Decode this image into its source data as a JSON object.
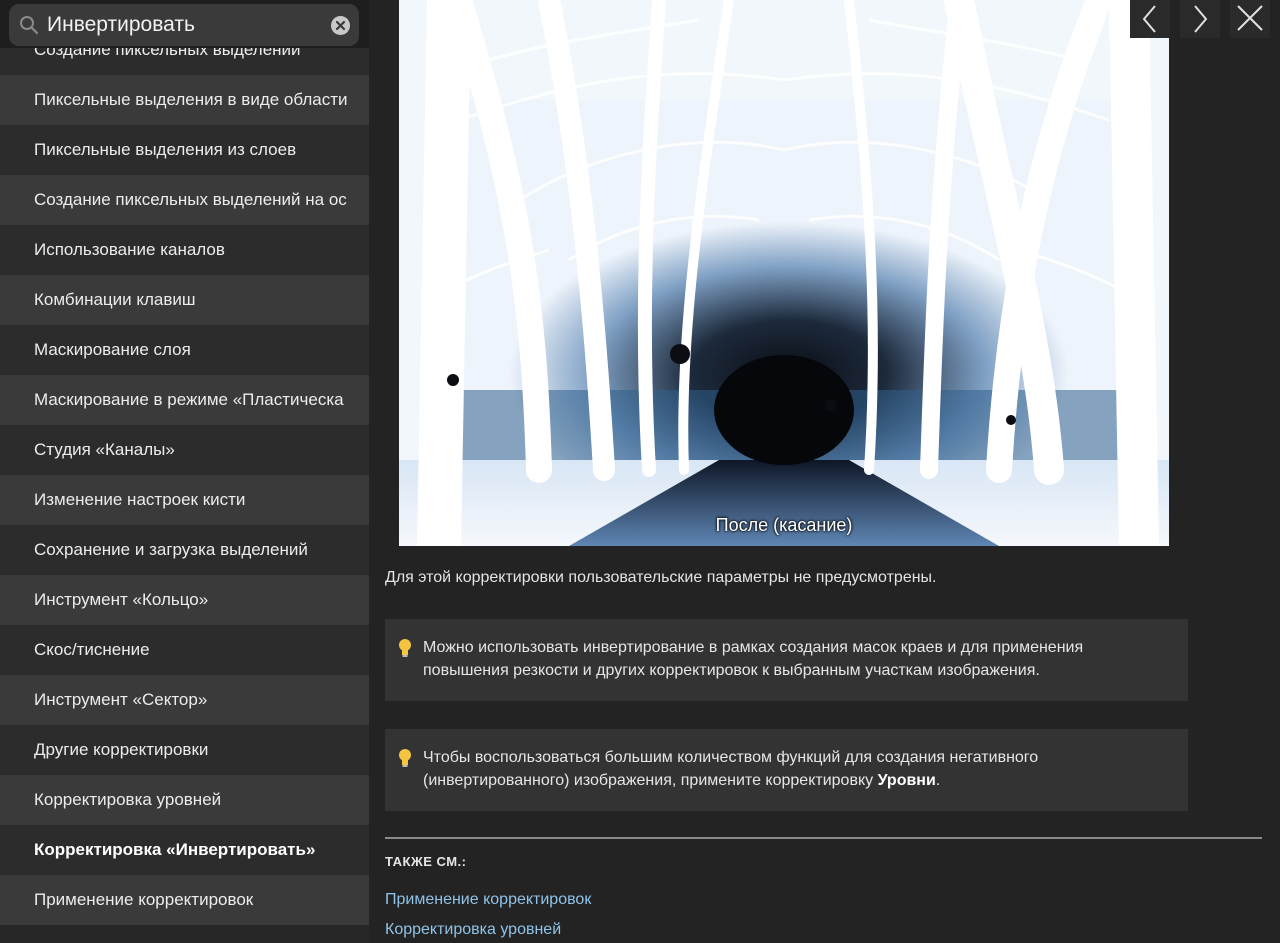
{
  "search": {
    "value": "Инвертировать",
    "icon": "search-icon",
    "clear_icon": "clear-icon"
  },
  "sidebar": {
    "items": [
      {
        "label": "Создание пиксельных выделений"
      },
      {
        "label": "Пиксельные выделения в виде области"
      },
      {
        "label": "Пиксельные выделения из слоев"
      },
      {
        "label": "Создание пиксельных выделений на ос"
      },
      {
        "label": "Использование каналов"
      },
      {
        "label": "Комбинации клавиш"
      },
      {
        "label": "Маскирование слоя"
      },
      {
        "label": "Маскирование в режиме «Пластическа"
      },
      {
        "label": "Студия «Каналы»"
      },
      {
        "label": "Изменение настроек кисти"
      },
      {
        "label": "Сохранение и загрузка выделений"
      },
      {
        "label": "Инструмент «Кольцо»"
      },
      {
        "label": "Скос/тиснение"
      },
      {
        "label": "Инструмент «Сектор»"
      },
      {
        "label": "Другие корректировки"
      },
      {
        "label": "Корректировка уровней"
      },
      {
        "label": "Корректировка «Инвертировать»",
        "active": true
      },
      {
        "label": "Применение корректировок"
      }
    ]
  },
  "image": {
    "caption": "После (касание)"
  },
  "toolbar": {
    "prev_icon": "chevron-left-icon",
    "next_icon": "chevron-right-icon",
    "close_icon": "close-icon"
  },
  "content": {
    "description": "Для этой корректировки пользовательские параметры не предусмотрены.",
    "tip1": "Можно использовать инвертирование в рамках создания масок краев и для применения повышения резкости и других корректировок к выбранным участкам изображения.",
    "tip2_text": "Чтобы воспользоваться большим количеством функций для создания негативного (инвертированного) изображения, примените корректировку",
    "tip2_bold": "Уровни",
    "tip2_end": ".",
    "tip_icon": "lightbulb-icon",
    "see_also": "ТАКЖЕ СМ.:",
    "links": [
      "Применение корректировок",
      "Корректировка уровней"
    ]
  },
  "colors": {
    "link": "#8fc3e8",
    "background": "#232323",
    "tip_bg": "#333333"
  }
}
